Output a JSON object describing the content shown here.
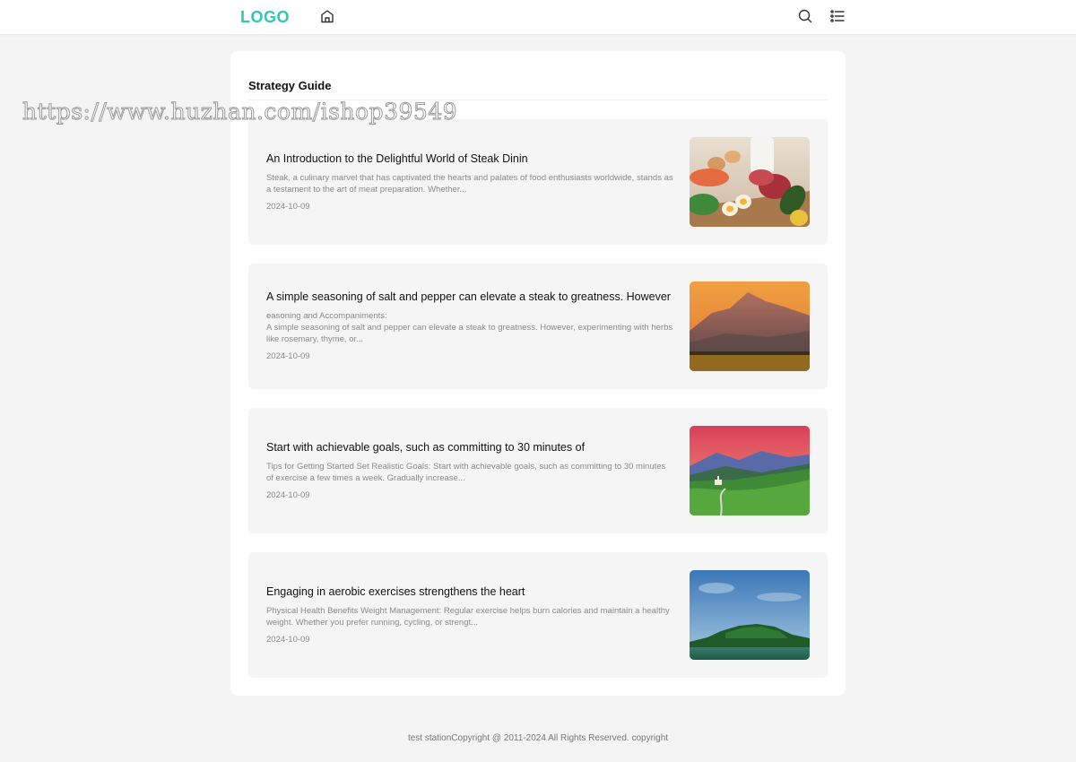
{
  "header": {
    "logo": "LOGO",
    "logo_color": "#2fc6b4",
    "home_icon": "home-icon",
    "search_icon": "search-icon",
    "menu_icon": "list-menu-icon"
  },
  "watermark": "https://www.huzhan.com/ishop39549",
  "main": {
    "section_title": "Strategy Guide",
    "articles": [
      {
        "title": "An Introduction to the Delightful World of Steak Dinin",
        "desc": "Steak, a culinary marvel that has captivated the hearts and palates of food enthusiasts worldwide, stands as a testament to the art of meat preparation. Whether...",
        "date": "2024-10-09",
        "image": "food-still-life"
      },
      {
        "title": "A simple seasoning of salt and pepper can elevate a steak to greatness. However",
        "desc": "easoning and Accompaniments:\nA simple seasoning of salt and pepper can elevate a steak to greatness. However, experimenting with herbs like rosemary, thyme, or...",
        "date": "2024-10-09",
        "image": "mountain-sunset"
      },
      {
        "title": "Start with achievable goals, such as committing to 30 minutes of",
        "desc": "Tips for Getting Started Set Realistic Goals: Start with achievable goals, such as committing to 30 minutes of exercise a few times a week. Gradually increase...",
        "date": "2024-10-09",
        "image": "alpine-valley"
      },
      {
        "title": "Engaging in aerobic exercises strengthens the heart",
        "desc": "Physical Health Benefits Weight Management: Regular exercise helps burn calories and maintain a healthy weight. Whether you prefer running, cycling, or strengt...",
        "date": "2024-10-09",
        "image": "lake-island"
      }
    ]
  },
  "footer": {
    "text": "test stationCopyright @ 2011-2024 All Rights Reserved. copyright"
  }
}
